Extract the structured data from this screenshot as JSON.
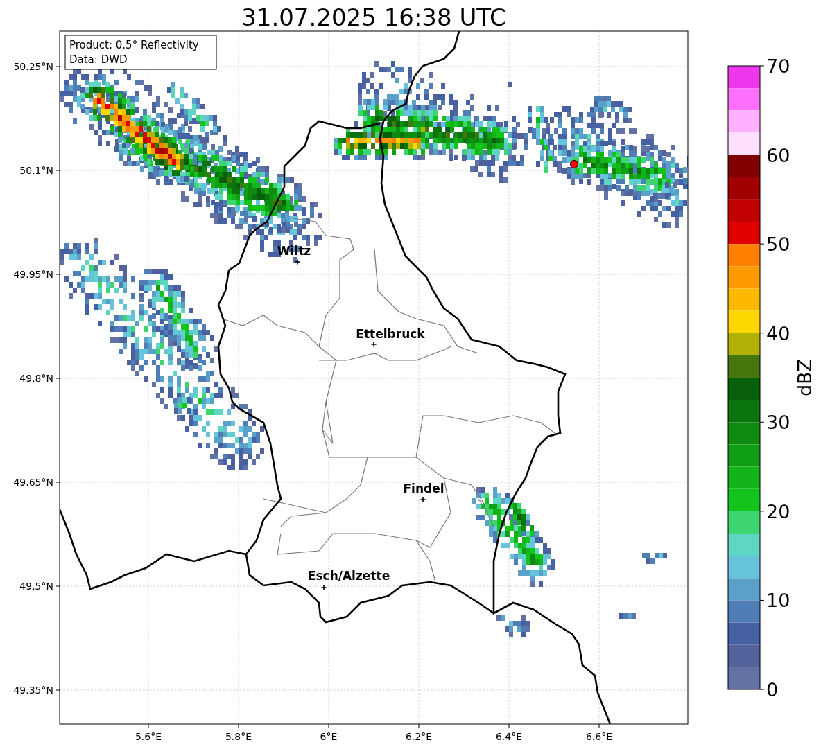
{
  "figure": {
    "title": "31.07.2025 16:38 UTC"
  },
  "info_box": [
    "Product: 0.5° Reflectivity",
    "Data: DWD"
  ],
  "map": {
    "x_tick_labels": [
      "5.6°E",
      "5.8°E",
      "6°E",
      "6.2°E",
      "6.4°E",
      "6.6°E"
    ],
    "y_tick_labels": [
      "50.25°N",
      "50.1°N",
      "49.95°N",
      "49.8°N",
      "49.65°N",
      "49.5°N",
      "49.35°N"
    ],
    "cities": [
      {
        "name": "Wiltz"
      },
      {
        "name": "Ettelbruck"
      },
      {
        "name": "Findel"
      },
      {
        "name": "Esch/Alzette"
      }
    ],
    "radar_station": {
      "color": "#ff0000"
    }
  },
  "colorbar": {
    "label": "dBZ",
    "ticks": [
      "70",
      "60",
      "50",
      "40",
      "30",
      "20",
      "10",
      "0"
    ],
    "segments": [
      {
        "color": "#ee38ee"
      },
      {
        "color": "#ff70ff"
      },
      {
        "color": "#ffb0ff"
      },
      {
        "color": "#ffe0ff"
      },
      {
        "color": "#800000"
      },
      {
        "color": "#a00000"
      },
      {
        "color": "#c00000"
      },
      {
        "color": "#e00000"
      },
      {
        "color": "#ff7f00"
      },
      {
        "color": "#ff9a00"
      },
      {
        "color": "#ffb800"
      },
      {
        "color": "#ffd700"
      },
      {
        "color": "#b2b206"
      },
      {
        "color": "#46760e"
      },
      {
        "color": "#075f0b"
      },
      {
        "color": "#0b740d"
      },
      {
        "color": "#0f8a10"
      },
      {
        "color": "#109f14"
      },
      {
        "color": "#13b419"
      },
      {
        "color": "#12c41c"
      },
      {
        "color": "#3dd56f"
      },
      {
        "color": "#5ed6c4"
      },
      {
        "color": "#66c3dc"
      },
      {
        "color": "#5aa0c8"
      },
      {
        "color": "#4f7db5"
      },
      {
        "color": "#4661a3"
      },
      {
        "color": "#52639c"
      },
      {
        "color": "#6272a4"
      }
    ]
  }
}
